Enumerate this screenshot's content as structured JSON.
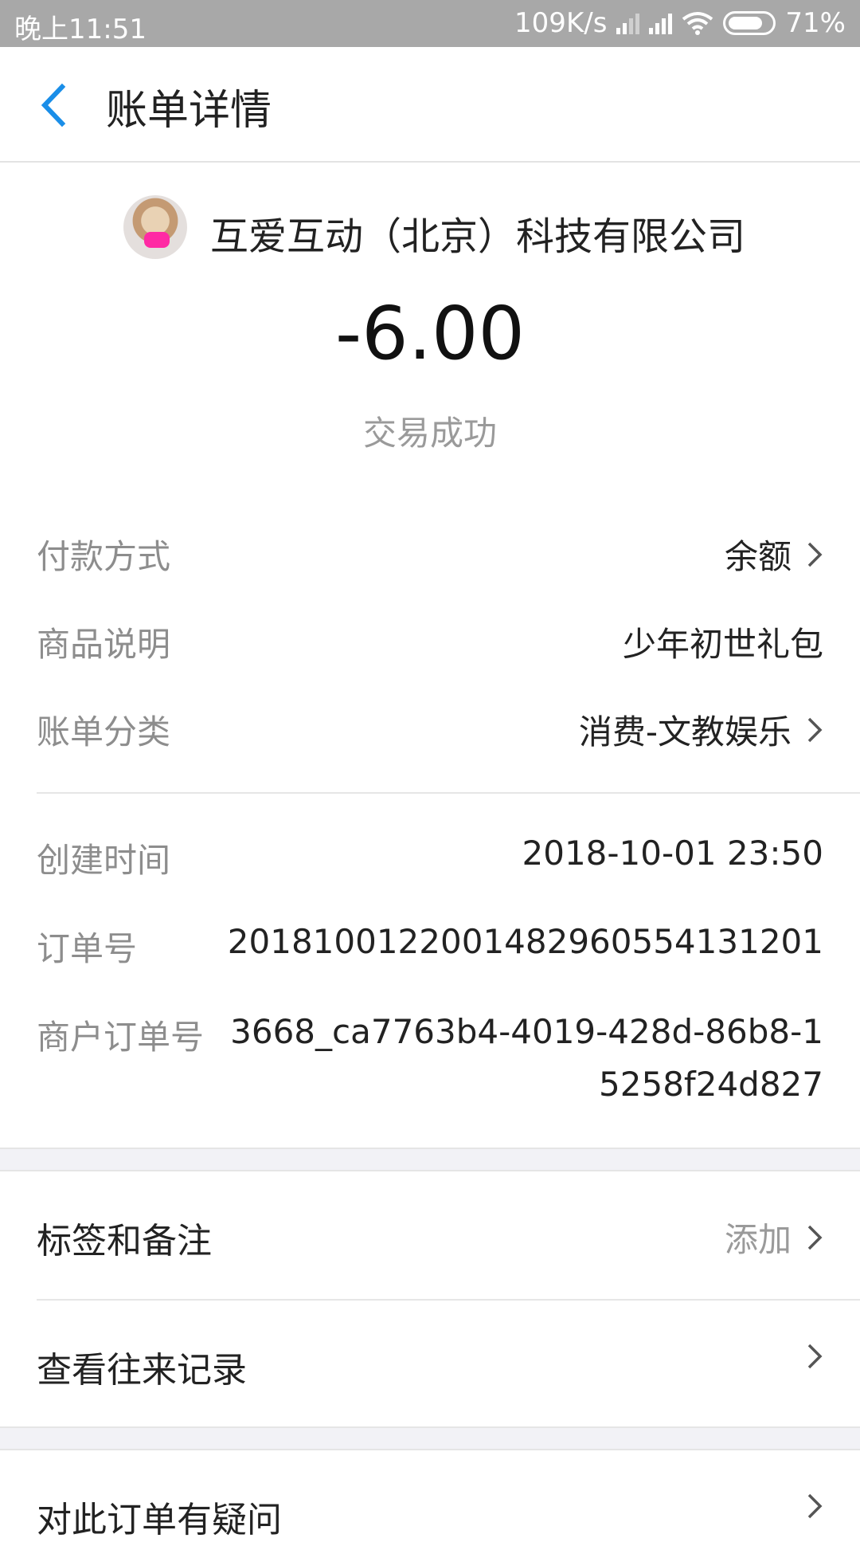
{
  "status_bar": {
    "time": "晚上11:51",
    "network_speed": "109K/s",
    "battery": "71%",
    "icons": [
      "signal-icon",
      "signal-icon",
      "wifi-icon",
      "battery-icon"
    ]
  },
  "header": {
    "title": "账单详情",
    "back_icon": "chevron-left-icon",
    "accent_color": "#1a8ee8"
  },
  "merchant": {
    "name": "互爱互动（北京）科技有限公司",
    "amount": "-6.00",
    "status": "交易成功"
  },
  "details": {
    "payment_method_label": "付款方式",
    "payment_method_value": "余额",
    "product_label": "商品说明",
    "product_value": "少年初世礼包",
    "category_label": "账单分类",
    "category_value": "消费-文教娱乐",
    "created_label": "创建时间",
    "created_value": "2018-10-01 23:50",
    "order_no_label": "订单号",
    "order_no_value": "2018100122001482960554131201",
    "merchant_order_label": "商户订单号",
    "merchant_order_value": "3668_ca7763b4-4019-428d-86b8-15258f24d827"
  },
  "menu": {
    "tags_label": "标签和备注",
    "tags_action": "添加",
    "history_label": "查看往来记录",
    "question_label": "对此订单有疑问"
  }
}
